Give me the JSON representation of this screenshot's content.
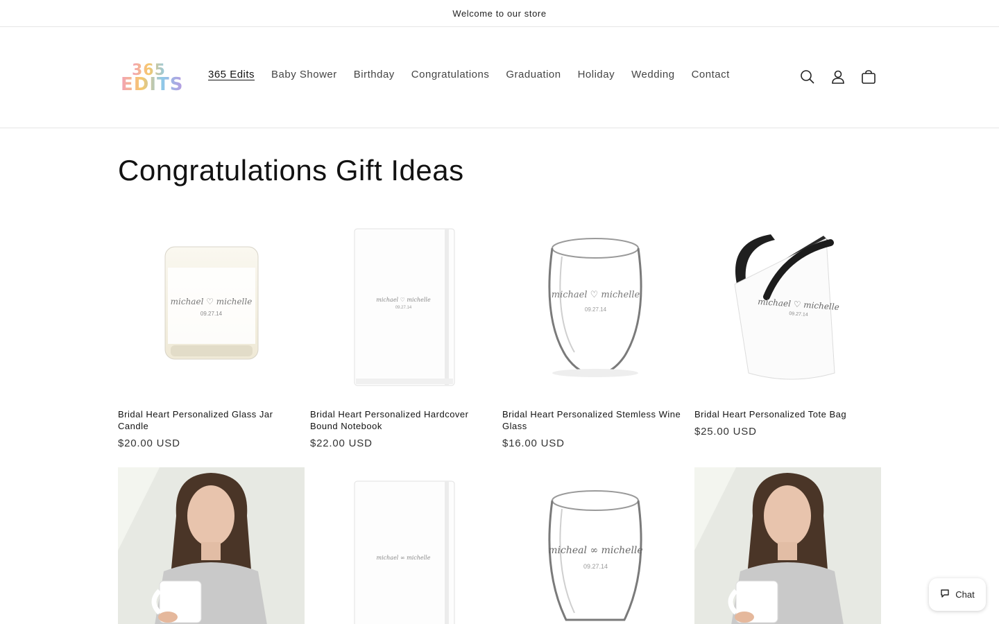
{
  "announcement": {
    "text": "Welcome to our store"
  },
  "logo": {
    "line1": "365",
    "line2": "EDITS"
  },
  "nav": {
    "items": [
      {
        "label": "365 Edits",
        "active": true
      },
      {
        "label": "Baby Shower"
      },
      {
        "label": "Birthday"
      },
      {
        "label": "Congratulations"
      },
      {
        "label": "Graduation"
      },
      {
        "label": "Holiday"
      },
      {
        "label": "Wedding"
      },
      {
        "label": "Contact"
      }
    ]
  },
  "header_icons": [
    "search-icon",
    "account-icon",
    "cart-icon"
  ],
  "page": {
    "title": "Congratulations Gift Ideas"
  },
  "products": [
    {
      "name": "Bridal Heart Personalized Glass Jar Candle",
      "price": "$20.00 USD",
      "image": "candle",
      "engraving": "michael ♡ michelle",
      "date": "09.27.14"
    },
    {
      "name": "Bridal Heart Personalized Hardcover Bound Notebook",
      "price": "$22.00 USD",
      "image": "notebook",
      "engraving": "michael ♡ michelle",
      "date": "09.27.14"
    },
    {
      "name": "Bridal Heart Personalized Stemless Wine Glass",
      "price": "$16.00 USD",
      "image": "wineglass",
      "engraving": "michael ♡ michelle",
      "date": "09.27.14"
    },
    {
      "name": "Bridal Heart Personalized Tote Bag",
      "price": "$25.00 USD",
      "image": "tote",
      "engraving": "michael ♡ michelle",
      "date": "09.27.14"
    },
    {
      "name": "",
      "price": "",
      "image": "photo-mug",
      "engraving": ""
    },
    {
      "name": "",
      "price": "",
      "image": "notebook",
      "engraving": "michael ∞ michelle",
      "date": ""
    },
    {
      "name": "",
      "price": "",
      "image": "wineglass",
      "engraving": "micheal ∞ michelle",
      "date": "09.27.14"
    },
    {
      "name": "",
      "price": "",
      "image": "photo-mug",
      "engraving": ""
    }
  ],
  "chat": {
    "label": "Chat"
  },
  "colors": {
    "accent_text": "#121212",
    "muted_text": "#444444",
    "border": "#e6e6e6",
    "logo_gradient": [
      "#f2a1b8",
      "#f7c86b",
      "#8ec9e8",
      "#b69ae0"
    ]
  }
}
